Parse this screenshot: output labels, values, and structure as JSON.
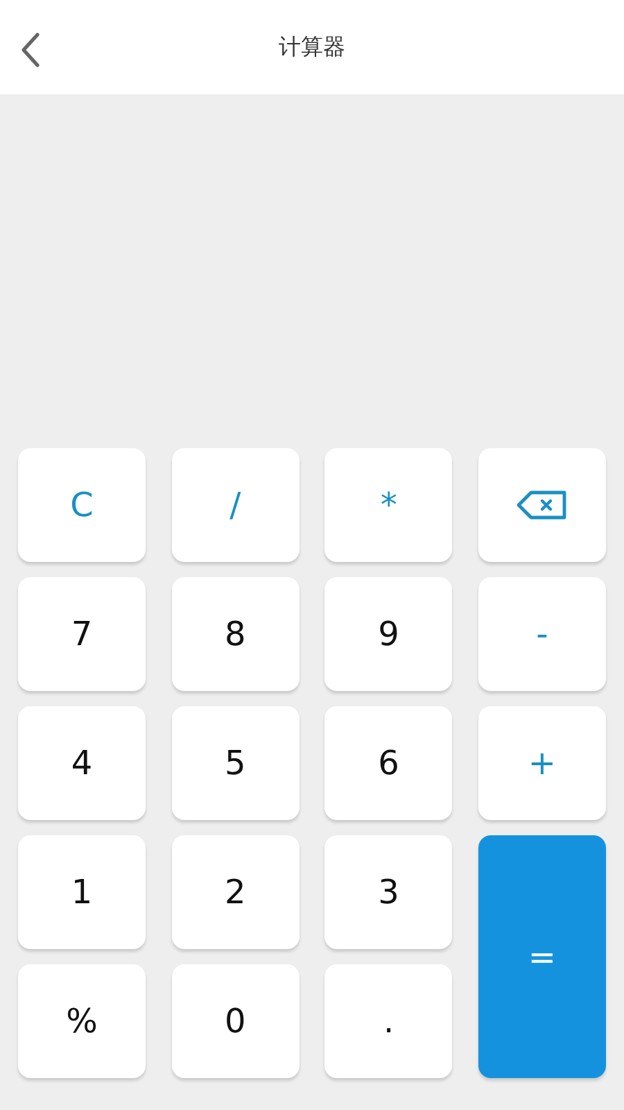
{
  "header": {
    "title": "计算器"
  },
  "keys": [
    {
      "kind": "operator",
      "label": "C"
    },
    {
      "kind": "operator",
      "label": "/"
    },
    {
      "kind": "operator",
      "label": "*"
    },
    {
      "kind": "backspace"
    },
    {
      "kind": "digit",
      "label": "7"
    },
    {
      "kind": "digit",
      "label": "8"
    },
    {
      "kind": "digit",
      "label": "9"
    },
    {
      "kind": "operator",
      "label": "-"
    },
    {
      "kind": "digit",
      "label": "4"
    },
    {
      "kind": "digit",
      "label": "5"
    },
    {
      "kind": "digit",
      "label": "6"
    },
    {
      "kind": "operator",
      "label": "+"
    },
    {
      "kind": "digit",
      "label": "1"
    },
    {
      "kind": "digit",
      "label": "2"
    },
    {
      "kind": "digit",
      "label": "3"
    },
    {
      "kind": "equals",
      "label": "="
    },
    {
      "kind": "digit",
      "label": "%"
    },
    {
      "kind": "digit",
      "label": "0"
    },
    {
      "kind": "digit",
      "label": "."
    }
  ]
}
